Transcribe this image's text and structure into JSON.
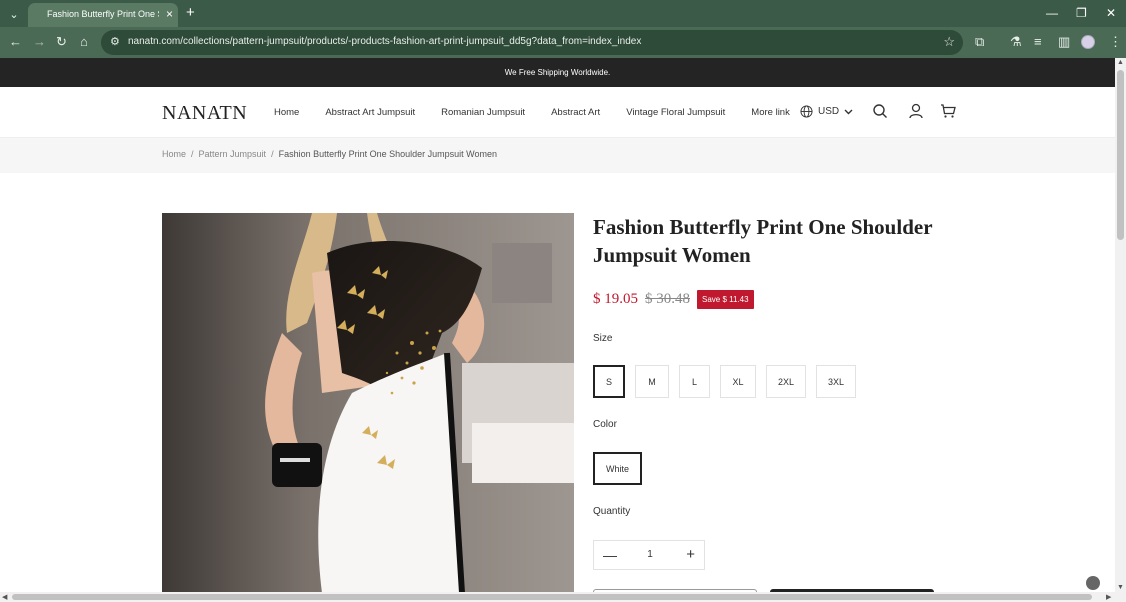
{
  "browser": {
    "tab_title": "Fashion Butterfly Print One Sho",
    "url": "nanatn.com/collections/pattern-jumpsuit/products/-products-fashion-art-print-jumpsuit_dd5g?data_from=index_index"
  },
  "announcement": "We Free Shipping Worldwide.",
  "header": {
    "logo": "NANATN",
    "menu": [
      "Home",
      "Abstract Art Jumpsuit",
      "Romanian Jumpsuit",
      "Abstract Art",
      "Vintage Floral Jumpsuit",
      "More link"
    ],
    "currency": "USD"
  },
  "breadcrumb": {
    "home": "Home",
    "collection": "Pattern Jumpsuit",
    "current": "Fashion Butterfly Print One Shoulder Jumpsuit Women"
  },
  "product": {
    "title": "Fashion Butterfly Print One Shoulder Jumpsuit Women",
    "price": "$ 19.05",
    "compare_price": "$ 30.48",
    "save_badge": "Save $ 11.43",
    "size_label": "Size",
    "sizes": [
      "S",
      "M",
      "L",
      "XL",
      "2XL",
      "3XL"
    ],
    "selected_size": "S",
    "color_label": "Color",
    "color": "White",
    "quantity_label": "Quantity",
    "quantity": "1"
  },
  "colors": {
    "accent": "#c0182e",
    "announcement_bg": "#242424",
    "chrome_tabbar": "#3c5a48",
    "chrome_navbar": "#4b6a56"
  }
}
